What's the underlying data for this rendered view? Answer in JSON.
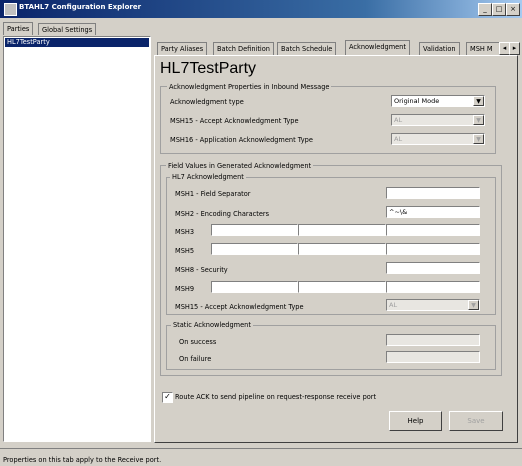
{
  "window": {
    "title": "BTAHL7 Configuration Explorer"
  },
  "left_tabs": [
    "Parties",
    "Global Settings"
  ],
  "tree": {
    "items": [
      "HL7TestParty"
    ]
  },
  "tabs": [
    "Party Aliases",
    "Batch Definition",
    "Batch Schedule",
    "Acknowledgment",
    "Validation",
    "MSH M"
  ],
  "party_name": "HL7TestParty",
  "ack_props": {
    "title": "Acknowledgment Properties in Inbound Message",
    "ack_type_label": "Acknowledgment type",
    "ack_type_value": "Original Mode",
    "msh15_label": "MSH15 - Accept Acknowledgment Type",
    "msh15_value": "AL",
    "msh16_label": "MSH16 - Application Acknowledgment Type",
    "msh16_value": "AL"
  },
  "field_values": {
    "title": "Field Values in Generated Acknowledgment",
    "subtitle": "HL7 Acknowledgment",
    "msh1_label": "MSH1 - Field Separator",
    "msh1_value": "",
    "msh2_label": "MSH2 - Encoding Characters",
    "msh2_value": "^~\\&",
    "msh3_label": "MSH3",
    "msh5_label": "MSH5",
    "msh8_label": "MSH8 - Security",
    "msh9_label": "MSH9",
    "msh15_label": "MSH15 - Accept Acknowledgment Type",
    "msh15_value": "AL"
  },
  "static_ack": {
    "title": "Static Acknowledgment",
    "success_label": "On success",
    "failure_label": "On failure"
  },
  "route_ack_label": "Route ACK to send pipeline on request-response receive port",
  "route_ack_checked": true,
  "buttons": {
    "help": "Help",
    "save": "Save"
  },
  "status": "Properties on this tab apply to the Receive port."
}
